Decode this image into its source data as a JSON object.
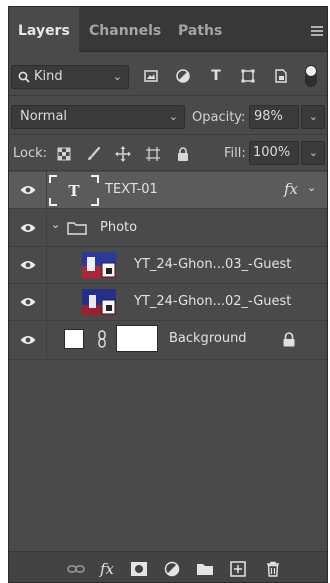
{
  "tabs": [
    {
      "label": "Layers",
      "active": true
    },
    {
      "label": "Channels",
      "active": false
    },
    {
      "label": "Paths",
      "active": false
    }
  ],
  "filter": {
    "kind_label": "Kind"
  },
  "blend": {
    "mode": "Normal",
    "opacity_label": "Opacity:",
    "opacity_value": "98%"
  },
  "lock": {
    "label": "Lock:",
    "fill_label": "Fill:",
    "fill_value": "100%"
  },
  "layers": [
    {
      "name": "TEXT-01",
      "type": "text",
      "selected": true,
      "fx": "fx"
    },
    {
      "name": "Photo",
      "type": "group"
    },
    {
      "name": "YT_24-Ghon...03_-Guest",
      "type": "smart-object"
    },
    {
      "name": "YT_24-Ghon...02_-Guest",
      "type": "smart-object"
    },
    {
      "name": "Background",
      "type": "background",
      "locked": true
    }
  ],
  "colors": {
    "panel_bg": "#4a4a4a",
    "tab_bar": "#383838",
    "selected_row": "#5b5b5b"
  }
}
